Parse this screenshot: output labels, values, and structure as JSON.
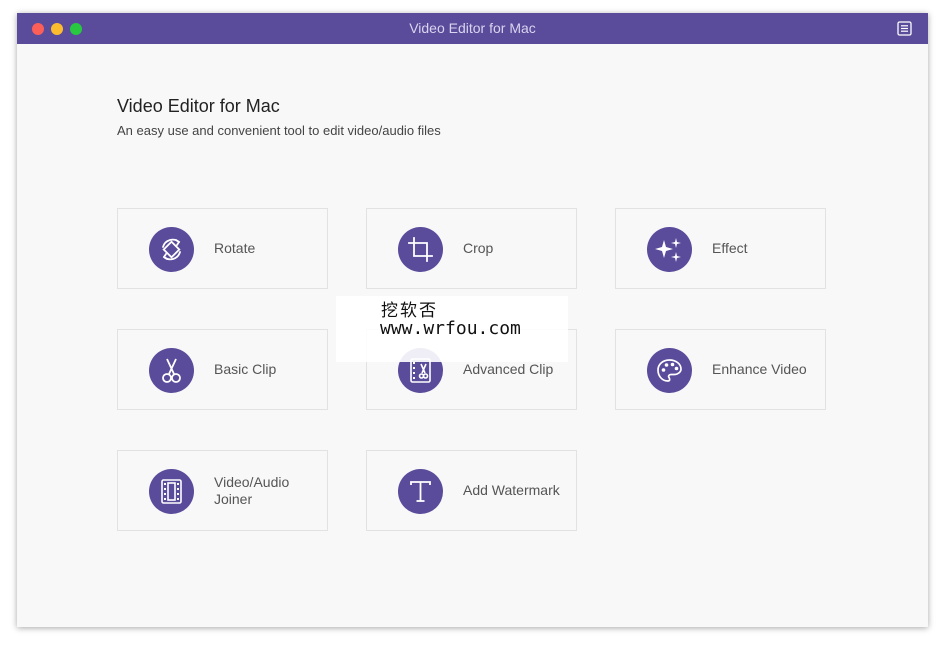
{
  "window": {
    "title": "Video Editor for Mac",
    "accent_color": "#5a4b9b"
  },
  "main": {
    "heading": "Video Editor for Mac",
    "subheading": "An easy use and convenient tool to edit video/audio files"
  },
  "tools": [
    {
      "label": "Rotate",
      "icon": "rotate-icon"
    },
    {
      "label": "Crop",
      "icon": "crop-icon"
    },
    {
      "label": "Effect",
      "icon": "sparkle-icon"
    },
    {
      "label": "Basic Clip",
      "icon": "scissors-icon"
    },
    {
      "label": "Advanced Clip",
      "icon": "film-scissors-icon"
    },
    {
      "label": "Enhance Video",
      "icon": "palette-icon"
    },
    {
      "label": "Video/Audio Joiner",
      "icon": "film-strip-icon"
    },
    {
      "label": "Add Watermark",
      "icon": "text-t-icon"
    }
  ],
  "overlay_watermark": {
    "line1": "挖软否",
    "line2": "www.wrfou.com"
  }
}
